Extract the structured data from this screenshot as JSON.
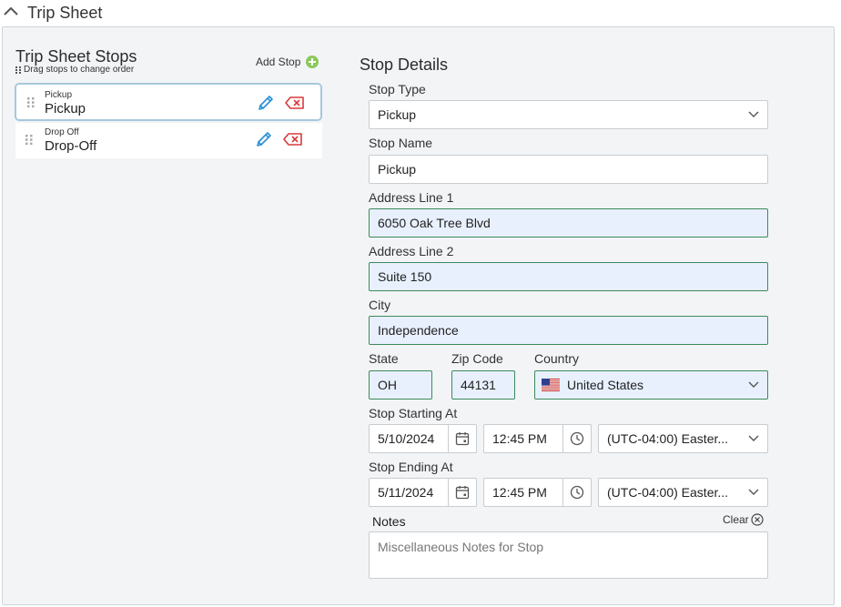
{
  "section": {
    "title": "Trip Sheet"
  },
  "stops_panel": {
    "title": "Trip Sheet Stops",
    "hint": "Drag stops to change order",
    "add_label": "Add Stop",
    "stops": [
      {
        "type": "Pickup",
        "name": "Pickup",
        "active": true
      },
      {
        "type": "Drop Off",
        "name": "Drop-Off",
        "active": false
      }
    ]
  },
  "details": {
    "title": "Stop Details",
    "stop_type": {
      "label": "Stop Type",
      "value": "Pickup"
    },
    "stop_name": {
      "label": "Stop Name",
      "value": "Pickup"
    },
    "address1": {
      "label": "Address Line 1",
      "value": "6050 Oak Tree Blvd"
    },
    "address2": {
      "label": "Address Line 2",
      "value": "Suite 150"
    },
    "city": {
      "label": "City",
      "value": "Independence"
    },
    "state": {
      "label": "State",
      "value": "OH"
    },
    "zip": {
      "label": "Zip Code",
      "value": "44131"
    },
    "country": {
      "label": "Country",
      "value": "United States",
      "flag": "us-flag-icon"
    },
    "start": {
      "label": "Stop Starting At",
      "date": "5/10/2024",
      "time": "12:45 PM",
      "timezone": "(UTC-04:00) Easter..."
    },
    "end": {
      "label": "Stop Ending At",
      "date": "5/11/2024",
      "time": "12:45 PM",
      "timezone": "(UTC-04:00) Easter..."
    },
    "notes": {
      "label": "Notes",
      "clear_label": "Clear",
      "placeholder": "Miscellaneous Notes for Stop"
    }
  },
  "colors": {
    "panel_bg": "#f2f4f6",
    "filled_bg": "#e8f0fe",
    "filled_border": "#3d8a5c",
    "edit_blue": "#2a8fd6",
    "delete_red": "#d83b3b",
    "add_green": "#7cc54a"
  }
}
